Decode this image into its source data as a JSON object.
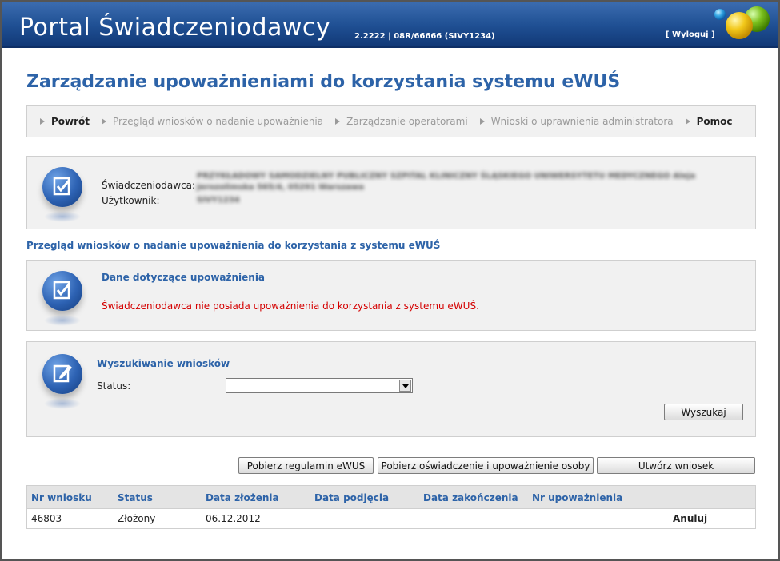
{
  "header": {
    "title": "Portal Świadczeniodawcy",
    "version": "2.2222 | 08R/66666 (SIVY1234)",
    "logout": "[ Wyloguj ]"
  },
  "page_title": "Zarządzanie upoważnieniami do korzystania systemu eWUŚ",
  "nav": [
    {
      "label": "Powrót",
      "strong": true
    },
    {
      "label": "Przegląd wniosków o nadanie upoważnienia",
      "strong": false
    },
    {
      "label": "Zarządzanie operatorami",
      "strong": false
    },
    {
      "label": "Wnioski o uprawnienia administratora",
      "strong": false
    },
    {
      "label": "Pomoc",
      "strong": true
    }
  ],
  "info": {
    "provider_label": "Świadczeniodawca:",
    "provider_value": "PRZYKŁADOWY SAMODZIELNY PUBLICZNY SZPITAL KLINICZNY ŚLĄSKIEGO UNIWERSYTETU MEDYCZNEGO Aleja Jerozolimska 565/4, 05291 Warszawa",
    "user_label": "Użytkownik:",
    "user_value": "SIVY1234"
  },
  "section_heading": "Przegląd wniosków o nadanie upoważnienia do korzystania z systemu eWUŚ",
  "authorization": {
    "heading": "Dane dotyczące upoważnienia",
    "message": "Świadczeniodawca nie posiada upoważnienia do korzystania z systemu eWUŚ."
  },
  "search": {
    "heading": "Wyszukiwanie wniosków",
    "status_label": "Status:",
    "status_value": "",
    "button": "Wyszukaj"
  },
  "actions": {
    "download_rules": "Pobierz regulamin eWUŚ",
    "download_statement": "Pobierz oświadczenie i upoważnienie osoby",
    "create": "Utwórz wniosek"
  },
  "table": {
    "columns": [
      "Nr wniosku",
      "Status",
      "Data złożenia",
      "Data podjęcia",
      "Data zakończenia",
      "Nr upoważnienia"
    ],
    "rows": [
      {
        "number": "46803",
        "status": "Złożony",
        "submitted": "06.12.2012",
        "started": "",
        "finished": "",
        "auth_no": "",
        "action": "Anuluj"
      }
    ]
  },
  "colors": {
    "accent": "#2d63a8",
    "header_bg": "#1f4f93",
    "error": "#d40000"
  }
}
